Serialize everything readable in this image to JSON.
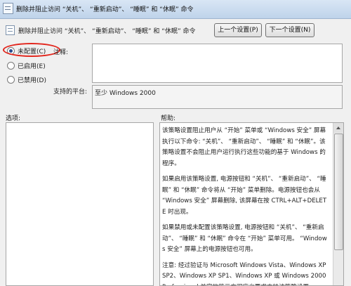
{
  "window": {
    "title": "删除并阻止访问 “关机”、 “重新启动”、 “睡眠” 和 “休眠” 命令"
  },
  "header": {
    "title": "删除并阻止访问 “关机”、 “重新启动”、 “睡眠” 和 “休眠” 命令"
  },
  "buttons": {
    "prev": "上一个设置(P)",
    "next": "下一个设置(N)"
  },
  "radios": [
    {
      "label": "未配置(C)",
      "checked": true
    },
    {
      "label": "已启用(E)",
      "checked": false
    },
    {
      "label": "已禁用(D)",
      "checked": false
    }
  ],
  "labels": {
    "comment": "注释:",
    "platform": "支持的平台:",
    "options": "选项:",
    "help": "帮助:"
  },
  "comment": "",
  "platform": "至少 Windows 2000",
  "help": [
    "该策略设置阻止用户从 “开始” 菜单或 “Windows 安全” 屏幕执行以下命令: “关机”、 “重新启动”、 “睡眠” 和 “休眠”。该策略设置不会阻止用户运行执行这些功能的基于 Windows 的程序。",
    "如果启用该策略设置, 电源按钮和 “关机”、 “重新启动”、 “睡眠” 和 “休眠” 命令将从 “开始” 菜单删除。电源按钮也会从 “Windows 安全” 屏幕删除, 该屏幕在按 CTRL+ALT+DELETE 时出现。",
    "如果禁用或未配置该策略设置, 电源按钮和 “关机”、 “重新启动”、 “睡眠” 和 “休眠” 命令在 “开始” 菜单可用。 “Windows 安全” 屏幕上的电源按钮也可用。",
    "注意: 经过验证与 Microsoft Windows Vista、Windows XP SP2、Windows XP SP1、Windows XP 或 Windows 2000 Professional 兼容的第三方程序也要求支持该策略设置。"
  ]
}
